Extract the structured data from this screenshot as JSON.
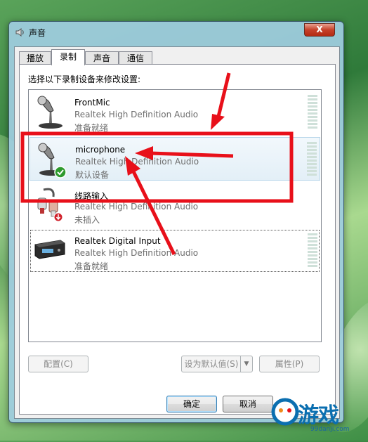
{
  "window": {
    "title": "声音",
    "close_label": "X"
  },
  "tabs": [
    {
      "label": "播放",
      "active": false
    },
    {
      "label": "录制",
      "active": true
    },
    {
      "label": "声音",
      "active": false
    },
    {
      "label": "通信",
      "active": false
    }
  ],
  "instruction": "选择以下录制设备来修改设置:",
  "devices": [
    {
      "name": "FrontMic",
      "description": "Realtek High Definition Audio",
      "status": "准备就绪",
      "icon": "microphone-icon",
      "selected": false
    },
    {
      "name": "microphone",
      "description": "Realtek High Definition Audio",
      "status": "默认设备",
      "icon": "microphone-icon",
      "selected": true,
      "default_badge": "check-badge-icon"
    },
    {
      "name": "线路输入",
      "description": "Realtek High Definition Audio",
      "status": "未插入",
      "icon": "line-in-cable-icon",
      "selected": false,
      "unplugged_badge": "unplugged-badge-icon"
    },
    {
      "name": "Realtek Digital Input",
      "description": "Realtek High Definition Audio",
      "status": "准备就绪",
      "icon": "digital-input-device-icon",
      "selected": false,
      "focused": true
    }
  ],
  "buttons": {
    "configure": "配置(C)",
    "set_default": "设为默认值(S)",
    "properties": "属性(P)",
    "ok": "确定",
    "cancel": "取消"
  },
  "watermark": {
    "text": "游戏",
    "url": "99danji.com"
  },
  "colors": {
    "highlight_box": "#e8101a",
    "arrow": "#e8101a",
    "selected_row": "#e3eff7",
    "check_badge": "#2e9a2e",
    "unplugged_badge": "#d0202a"
  }
}
